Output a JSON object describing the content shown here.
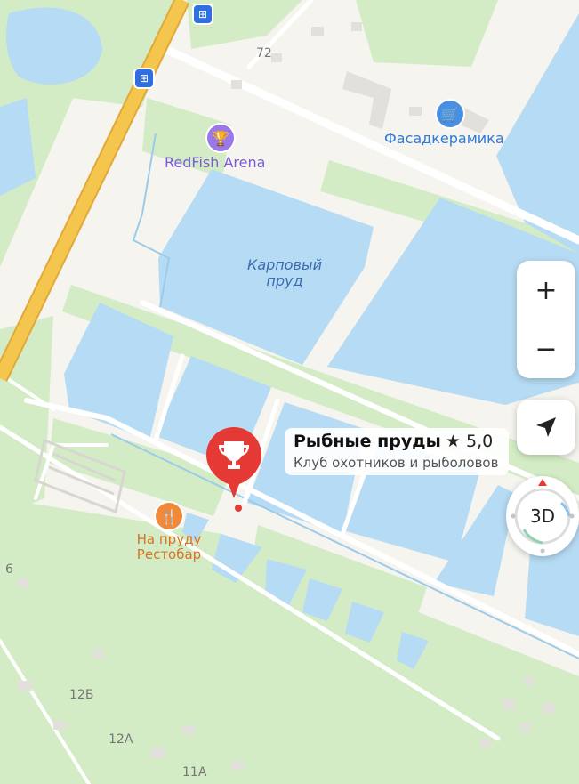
{
  "map": {
    "colors": {
      "land": "#f5f4ee",
      "water": "#b6dbf4",
      "green": "#d3ecc6",
      "road_major": "#f4c64e",
      "road_edge": "#e0a93a",
      "road_minor": "#ffffff",
      "building": "#e2e0db",
      "accent": "#e53935"
    }
  },
  "labels": {
    "house_72": "72",
    "house_12b": "12Б",
    "house_12a": "12А",
    "house_11a": "11А",
    "house_6": "6",
    "water": "Карповый пруд",
    "redfish": "RedFish Arena",
    "fasad": "Фасадкерамика",
    "restobar": "На пруду Рестобар"
  },
  "poi": {
    "redfish_icon": "trophy-icon",
    "fasad_icon": "shopping-cart-icon",
    "restobar_icon": "fork-knife-icon",
    "bus_icon": "bus-stop-icon"
  },
  "selected_place": {
    "name": "Рыбные пруды",
    "rating": "★ 5,0",
    "category": "Клуб охотников и рыболовов",
    "pin_icon": "trophy-icon"
  },
  "controls": {
    "zoom_in": "+",
    "zoom_out": "−",
    "view_3d": "3D"
  }
}
